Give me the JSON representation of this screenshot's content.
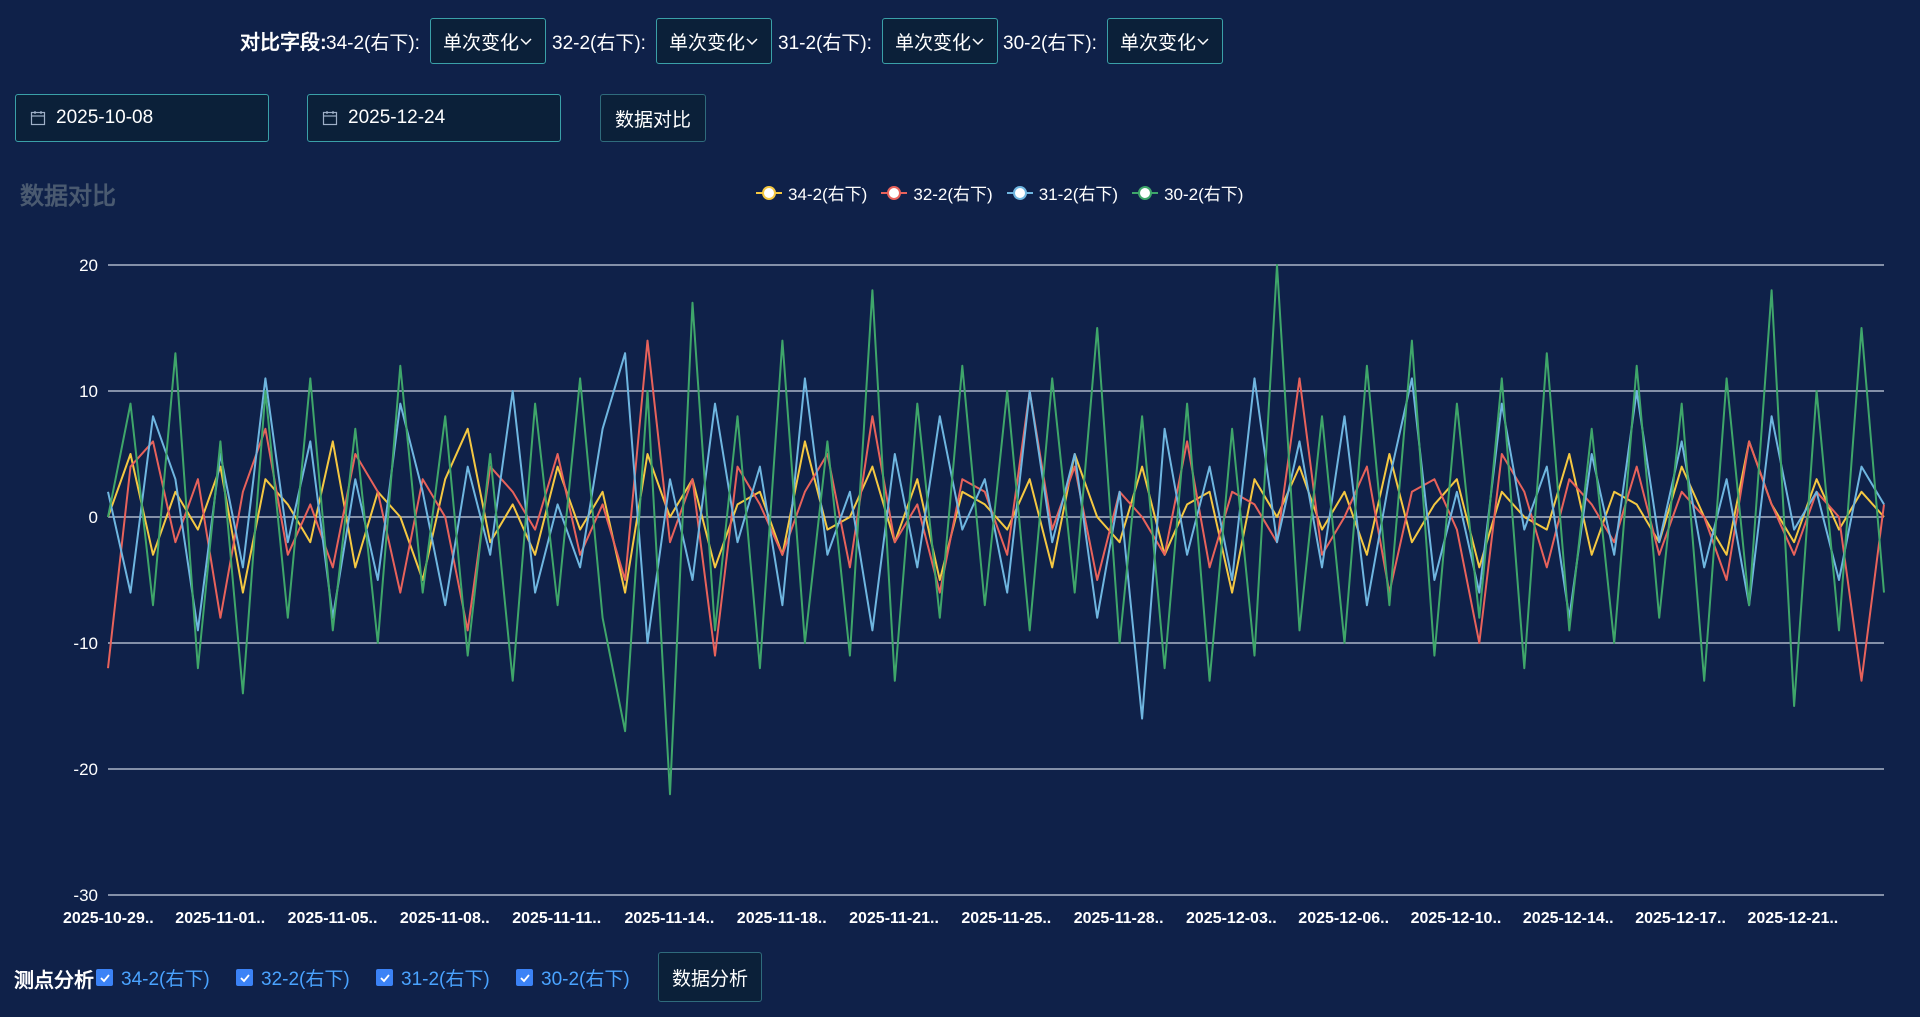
{
  "toolbar": {
    "fields_label": "对比字段:",
    "fields": [
      {
        "name": "34-2(右下):",
        "value": "单次变化"
      },
      {
        "name": "32-2(右下):",
        "value": "单次变化"
      },
      {
        "name": "31-2(右下):",
        "value": "单次变化"
      },
      {
        "name": "30-2(右下):",
        "value": "单次变化"
      }
    ],
    "start_date": "2025-10-08",
    "end_date": "2025-12-24",
    "compare_button": "数据对比"
  },
  "chart_title": "数据对比",
  "analysis": {
    "label": "测点分析",
    "points": [
      {
        "label": "34-2(右下)",
        "checked": true
      },
      {
        "label": "32-2(右下)",
        "checked": true
      },
      {
        "label": "31-2(右下)",
        "checked": true
      },
      {
        "label": "30-2(右下)",
        "checked": true
      }
    ],
    "analyze_button": "数据分析"
  },
  "colors": {
    "background": "#0f2149",
    "series_34": "#f5c842",
    "series_32": "#e8625b",
    "series_31": "#6fb6e0",
    "series_30": "#3fa66a",
    "checkbox": "#3b82f6",
    "check_label": "#4aa3ff"
  },
  "chart_data": {
    "type": "line",
    "legend_position": "top-center",
    "grid": true,
    "ylim": [
      -30,
      20
    ],
    "y_ticks": [
      20,
      10,
      0,
      -10,
      -20,
      -30
    ],
    "x_tick_labels": [
      "2025-10-29..",
      "2025-11-01..",
      "2025-11-05..",
      "2025-11-08..",
      "2025-11-11..",
      "2025-11-14..",
      "2025-11-18..",
      "2025-11-21..",
      "2025-11-25..",
      "2025-11-28..",
      "2025-12-03..",
      "2025-12-06..",
      "2025-12-10..",
      "2025-12-14..",
      "2025-12-17..",
      "2025-12-21.."
    ],
    "series": [
      {
        "name": "34-2(右下)",
        "color": "#f5c842",
        "values": [
          0,
          5,
          -3,
          2,
          -1,
          4,
          -6,
          3,
          1,
          -2,
          6,
          -4,
          2,
          0,
          -5,
          3,
          7,
          -2,
          1,
          -3,
          4,
          -1,
          2,
          -6,
          5,
          0,
          3,
          -4,
          1,
          2,
          -3,
          6,
          -1,
          0,
          4,
          -2,
          3,
          -5,
          2,
          1,
          -1,
          3,
          -4,
          5,
          0,
          -2,
          4,
          -3,
          1,
          2,
          -6,
          3,
          0,
          4,
          -1,
          2,
          -3,
          5,
          -2,
          1,
          3,
          -4,
          2,
          0,
          -1,
          5,
          -3,
          2,
          1,
          -2,
          4,
          0,
          -3,
          6,
          1,
          -2,
          3,
          -1,
          2,
          0
        ]
      },
      {
        "name": "32-2(右下)",
        "color": "#e8625b",
        "values": [
          -12,
          4,
          6,
          -2,
          3,
          -8,
          2,
          7,
          -3,
          1,
          -4,
          5,
          2,
          -6,
          3,
          0,
          -9,
          4,
          2,
          -1,
          5,
          -3,
          1,
          -5,
          14,
          -2,
          3,
          -11,
          4,
          1,
          -3,
          2,
          5,
          -4,
          8,
          -2,
          1,
          -6,
          3,
          2,
          -3,
          10,
          -1,
          4,
          -5,
          2,
          0,
          -3,
          6,
          -4,
          2,
          1,
          -2,
          11,
          -3,
          0,
          4,
          -6,
          2,
          3,
          -1,
          -10,
          5,
          2,
          -4,
          3,
          1,
          -2,
          4,
          -3,
          2,
          0,
          -5,
          6,
          1,
          -3,
          2,
          0,
          -13,
          1
        ]
      },
      {
        "name": "31-2(右下)",
        "color": "#6fb6e0",
        "values": [
          2,
          -6,
          8,
          3,
          -9,
          5,
          -4,
          11,
          -2,
          6,
          -8,
          3,
          -5,
          9,
          2,
          -7,
          4,
          -3,
          10,
          -6,
          1,
          -4,
          7,
          13,
          -10,
          3,
          -5,
          9,
          -2,
          4,
          -7,
          11,
          -3,
          2,
          -9,
          5,
          -4,
          8,
          -1,
          3,
          -6,
          10,
          -2,
          5,
          -8,
          2,
          -16,
          7,
          -3,
          4,
          -5,
          11,
          -2,
          6,
          -4,
          8,
          -7,
          3,
          11,
          -5,
          2,
          -6,
          9,
          -1,
          4,
          -8,
          5,
          -3,
          10,
          -2,
          6,
          -4,
          3,
          -7,
          8,
          -1,
          2,
          -5,
          4,
          1
        ]
      },
      {
        "name": "30-2(右下)",
        "color": "#3fa66a",
        "values": [
          0,
          9,
          -7,
          13,
          -12,
          6,
          -14,
          10,
          -8,
          11,
          -9,
          7,
          -10,
          12,
          -6,
          8,
          -11,
          5,
          -13,
          9,
          -7,
          11,
          -8,
          -17,
          10,
          -22,
          17,
          -9,
          8,
          -12,
          14,
          -10,
          6,
          -11,
          18,
          -13,
          9,
          -8,
          12,
          -7,
          10,
          -9,
          11,
          -6,
          15,
          -10,
          8,
          -12,
          9,
          -13,
          7,
          -11,
          20,
          -9,
          8,
          -10,
          12,
          -7,
          14,
          -11,
          9,
          -8,
          11,
          -12,
          13,
          -9,
          7,
          -10,
          12,
          -8,
          9,
          -13,
          11,
          -7,
          18,
          -15,
          10,
          -9,
          15,
          -6
        ]
      }
    ]
  }
}
